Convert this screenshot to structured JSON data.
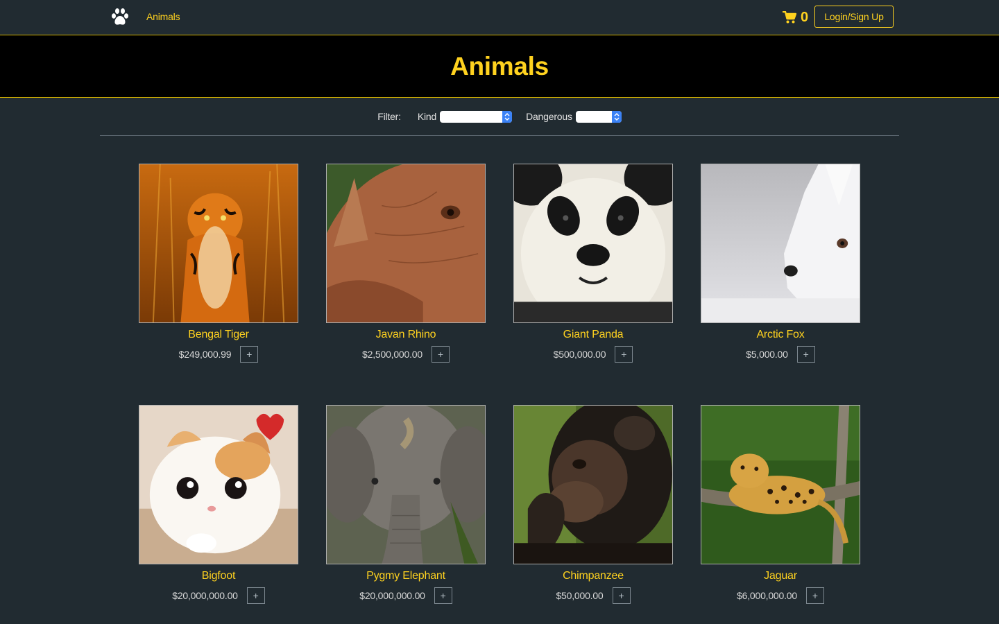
{
  "nav": {
    "brand_icon": "paw-icon",
    "link": "Animals",
    "cart_icon": "shopping-cart-icon",
    "cart_count": "0",
    "login_label": "Login/Sign Up"
  },
  "hero": {
    "title": "Animals"
  },
  "filter": {
    "label": "Filter:",
    "kind_label": "Kind",
    "kind_value": "",
    "dangerous_label": "Dangerous",
    "dangerous_value": ""
  },
  "colors": {
    "accent": "#ffd21f",
    "background": "#212b31",
    "hero": "#000000"
  },
  "products": [
    {
      "name": "Bengal Tiger",
      "price": "$249,000.99",
      "add": "+"
    },
    {
      "name": "Javan Rhino",
      "price": "$2,500,000.00",
      "add": "+"
    },
    {
      "name": "Giant Panda",
      "price": "$500,000.00",
      "add": "+"
    },
    {
      "name": "Arctic Fox",
      "price": "$5,000.00",
      "add": "+"
    },
    {
      "name": "Bigfoot",
      "price": "$20,000,000.00",
      "add": "+"
    },
    {
      "name": "Pygmy Elephant",
      "price": "$20,000,000.00",
      "add": "+"
    },
    {
      "name": "Chimpanzee",
      "price": "$50,000.00",
      "add": "+"
    },
    {
      "name": "Jaguar",
      "price": "$6,000,000.00",
      "add": "+"
    }
  ]
}
